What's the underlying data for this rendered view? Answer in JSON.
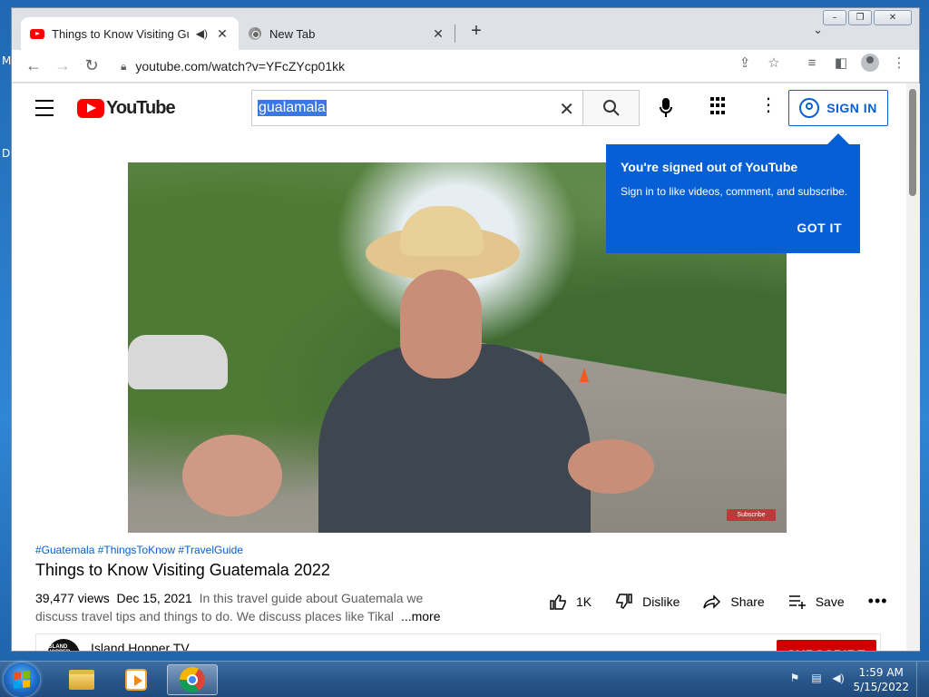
{
  "desktop": {
    "labels": [
      "M",
      "D"
    ]
  },
  "window": {
    "controls": {
      "minimize": "–",
      "restore": "❐",
      "close": "✕"
    }
  },
  "tabs": [
    {
      "title": "Things to Know Visiting Gua",
      "audio_icon": "speaker-icon",
      "close": "✕",
      "favicon": "youtube-favicon"
    },
    {
      "title": "New Tab",
      "close": "✕",
      "favicon": "chrome-favicon"
    }
  ],
  "tabstrip": {
    "new_tab": "+",
    "tab_search": "⌄"
  },
  "toolbar": {
    "url": "youtube.com/watch?v=YFcZYcp01kk"
  },
  "youtube": {
    "logo_text": "YouTube",
    "search_value": "gualamala",
    "signin_label": "SIGN IN",
    "tooltip": {
      "title": "You're signed out of YouTube",
      "body": "Sign in to like videos, comment, and subscribe.",
      "button": "GOT IT"
    },
    "video": {
      "overlay_subscribe": "Subscribe",
      "hashtags": "#Guatemala #ThingsToKnow #TravelGuide",
      "title": "Things to Know Visiting Guatemala 2022",
      "views": "39,477 views",
      "date": "Dec 15, 2021",
      "description": "In this travel guide about Guatemala we discuss travel tips and things to do. We discuss places like Tikal",
      "more": "...more"
    },
    "actions": {
      "like_count": "1K",
      "dislike": "Dislike",
      "share": "Share",
      "save": "Save",
      "more": "•••"
    },
    "channel": {
      "name": "Island Hopper TV",
      "avatar_text": "ISLAND HOPPER",
      "subscribe": "SUBSCRIBE"
    }
  },
  "taskbar": {
    "clock_time": "1:59 AM",
    "clock_date": "5/15/2022"
  },
  "colors": {
    "yt_red": "#ff0000",
    "yt_blue": "#065fd4",
    "subscribe_red": "#cc0000"
  }
}
